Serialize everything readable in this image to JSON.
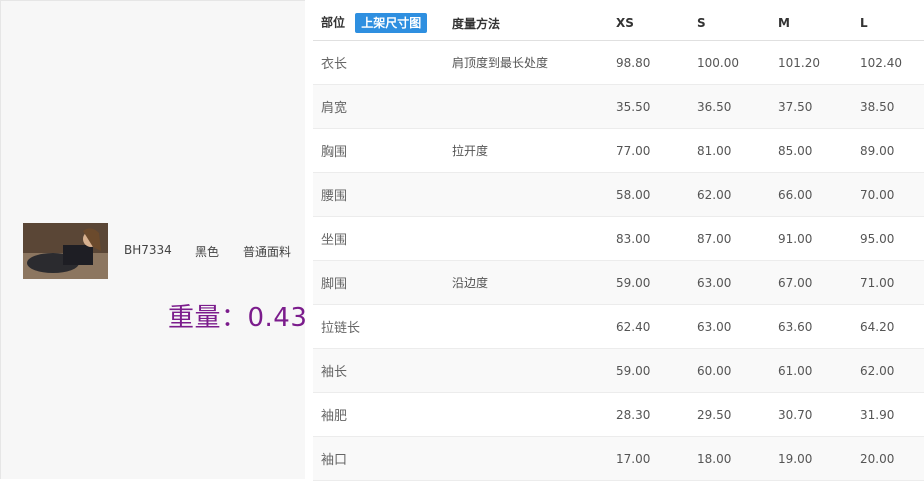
{
  "product": {
    "sku": "BH7334",
    "color": "黑色",
    "fabric": "普通面料",
    "weight_text": "重量：0.43"
  },
  "table": {
    "header": {
      "part": "部位",
      "size_chart_button": "上架尺寸图",
      "method": "度量方法",
      "sizes": [
        "XS",
        "S",
        "M",
        "L"
      ]
    },
    "rows": [
      {
        "part": "衣长",
        "method": "肩顶度到最长处度",
        "values": [
          "98.80",
          "100.00",
          "101.20",
          "102.40"
        ]
      },
      {
        "part": "肩宽",
        "method": "",
        "values": [
          "35.50",
          "36.50",
          "37.50",
          "38.50"
        ]
      },
      {
        "part": "胸围",
        "method": "拉开度",
        "values": [
          "77.00",
          "81.00",
          "85.00",
          "89.00"
        ]
      },
      {
        "part": "腰围",
        "method": "",
        "values": [
          "58.00",
          "62.00",
          "66.00",
          "70.00"
        ]
      },
      {
        "part": "坐围",
        "method": "",
        "values": [
          "83.00",
          "87.00",
          "91.00",
          "95.00"
        ]
      },
      {
        "part": "脚围",
        "method": "沿边度",
        "values": [
          "59.00",
          "63.00",
          "67.00",
          "71.00"
        ]
      },
      {
        "part": "拉链长",
        "method": "",
        "values": [
          "62.40",
          "63.00",
          "63.60",
          "64.20"
        ]
      },
      {
        "part": "袖长",
        "method": "",
        "values": [
          "59.00",
          "60.00",
          "61.00",
          "62.00"
        ]
      },
      {
        "part": "袖肥",
        "method": "",
        "values": [
          "28.30",
          "29.50",
          "30.70",
          "31.90"
        ]
      },
      {
        "part": "袖口",
        "method": "",
        "values": [
          "17.00",
          "18.00",
          "19.00",
          "20.00"
        ]
      }
    ]
  },
  "colors": {
    "weight_text": "#7b1c8c",
    "button_bg": "#2e8fe0",
    "panel_bg": "#f7f7f7"
  }
}
